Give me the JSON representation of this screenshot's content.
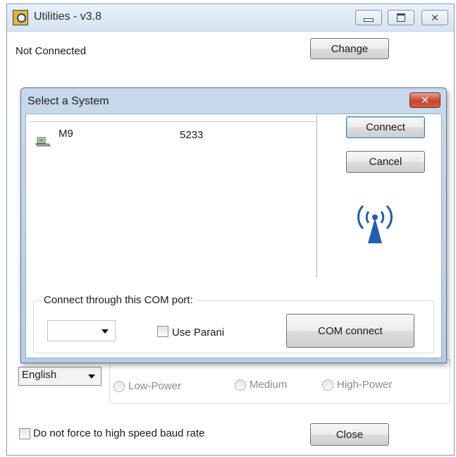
{
  "main_window": {
    "title": "Utilities - v3.8",
    "status": "Not Connected",
    "change_label": "Change",
    "language": "English",
    "power_options": [
      "Low-Power",
      "Medium",
      "High-Power"
    ],
    "baud_checkbox_label": "Do not force to high speed baud rate",
    "close_label": "Close",
    "icons": {
      "app": "app-icon",
      "minimize": "minimize-icon",
      "maximize": "maximize-icon",
      "close": "close-icon"
    }
  },
  "dialog": {
    "title": "Select a System",
    "close_glyph": "✕",
    "systems": [
      {
        "name": "M9",
        "id": "5233",
        "icon": "device-icon"
      }
    ],
    "connect_label": "Connect",
    "cancel_label": "Cancel",
    "wireless_icon": "wireless-icon",
    "com_group": {
      "label": "Connect through this COM port:",
      "port_value": "",
      "use_parani_label": "Use Parani",
      "com_connect_label": "COM connect"
    }
  },
  "colors": {
    "dialog_frame": "#b8cde3",
    "close_red": "#c7452c",
    "wireless_blue": "#1f5fb0"
  }
}
